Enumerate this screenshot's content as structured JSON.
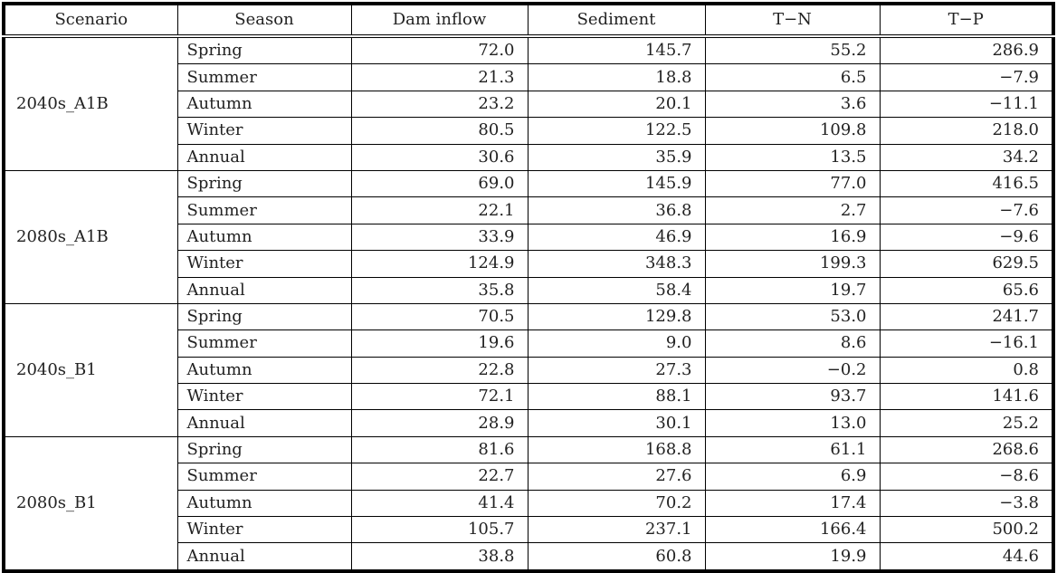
{
  "table": {
    "headers": [
      "Scenario",
      "Season",
      "Dam inflow",
      "Sediment",
      "T−N",
      "T−P"
    ],
    "groups": [
      {
        "scenario": "2040s_A1B",
        "rows": [
          {
            "season": "Spring",
            "dam_inflow": "72.0",
            "sediment": "145.7",
            "tn": "55.2",
            "tp": "286.9"
          },
          {
            "season": "Summer",
            "dam_inflow": "21.3",
            "sediment": "18.8",
            "tn": "6.5",
            "tp": "−7.9"
          },
          {
            "season": "Autumn",
            "dam_inflow": "23.2",
            "sediment": "20.1",
            "tn": "3.6",
            "tp": "−11.1"
          },
          {
            "season": "Winter",
            "dam_inflow": "80.5",
            "sediment": "122.5",
            "tn": "109.8",
            "tp": "218.0"
          },
          {
            "season": "Annual",
            "dam_inflow": "30.6",
            "sediment": "35.9",
            "tn": "13.5",
            "tp": "34.2"
          }
        ]
      },
      {
        "scenario": "2080s_A1B",
        "rows": [
          {
            "season": "Spring",
            "dam_inflow": "69.0",
            "sediment": "145.9",
            "tn": "77.0",
            "tp": "416.5"
          },
          {
            "season": "Summer",
            "dam_inflow": "22.1",
            "sediment": "36.8",
            "tn": "2.7",
            "tp": "−7.6"
          },
          {
            "season": "Autumn",
            "dam_inflow": "33.9",
            "sediment": "46.9",
            "tn": "16.9",
            "tp": "−9.6"
          },
          {
            "season": "Winter",
            "dam_inflow": "124.9",
            "sediment": "348.3",
            "tn": "199.3",
            "tp": "629.5"
          },
          {
            "season": "Annual",
            "dam_inflow": "35.8",
            "sediment": "58.4",
            "tn": "19.7",
            "tp": "65.6"
          }
        ]
      },
      {
        "scenario": "2040s_B1",
        "rows": [
          {
            "season": "Spring",
            "dam_inflow": "70.5",
            "sediment": "129.8",
            "tn": "53.0",
            "tp": "241.7"
          },
          {
            "season": "Summer",
            "dam_inflow": "19.6",
            "sediment": "9.0",
            "tn": "8.6",
            "tp": "−16.1"
          },
          {
            "season": "Autumn",
            "dam_inflow": "22.8",
            "sediment": "27.3",
            "tn": "−0.2",
            "tp": "0.8"
          },
          {
            "season": "Winter",
            "dam_inflow": "72.1",
            "sediment": "88.1",
            "tn": "93.7",
            "tp": "141.6"
          },
          {
            "season": "Annual",
            "dam_inflow": "28.9",
            "sediment": "30.1",
            "tn": "13.0",
            "tp": "25.2"
          }
        ]
      },
      {
        "scenario": "2080s_B1",
        "rows": [
          {
            "season": "Spring",
            "dam_inflow": "81.6",
            "sediment": "168.8",
            "tn": "61.1",
            "tp": "268.6"
          },
          {
            "season": "Summer",
            "dam_inflow": "22.7",
            "sediment": "27.6",
            "tn": "6.9",
            "tp": "−8.6"
          },
          {
            "season": "Autumn",
            "dam_inflow": "41.4",
            "sediment": "70.2",
            "tn": "17.4",
            "tp": "−3.8"
          },
          {
            "season": "Winter",
            "dam_inflow": "105.7",
            "sediment": "237.1",
            "tn": "166.4",
            "tp": "500.2"
          },
          {
            "season": "Annual",
            "dam_inflow": "38.8",
            "sediment": "60.8",
            "tn": "19.9",
            "tp": "44.6"
          }
        ]
      }
    ]
  }
}
